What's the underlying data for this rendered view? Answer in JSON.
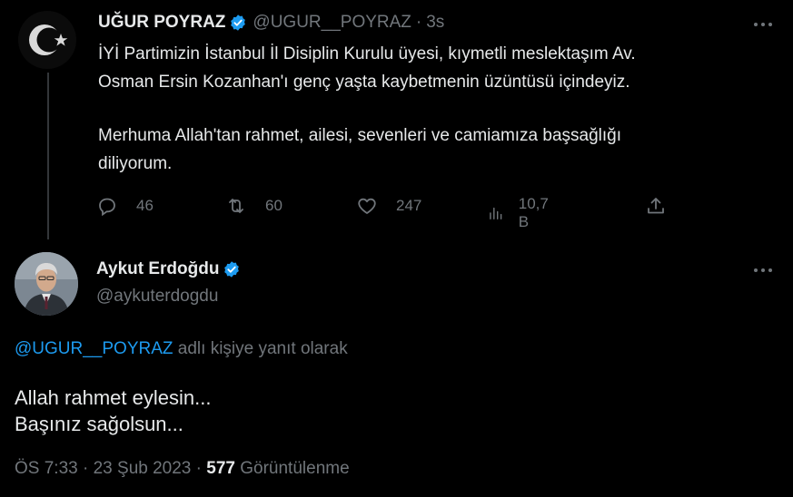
{
  "quoted_tweet": {
    "author_name": "UĞUR POYRAZ",
    "author_handle": "@UGUR__POYRAZ",
    "time_sep": "·",
    "time": "3s",
    "text_lines": [
      "İYİ Partimizin İstanbul İl Disiplin Kurulu üyesi, kıymetli meslektaşım Av.",
      "Osman Ersin Kozanhan'ı genç yaşta kaybetmenin üzüntüsü içindeyiz."
    ],
    "text_lines_2": [
      "Merhuma Allah'tan rahmet, ailesi, sevenleri ve camiamıza başsağlığı",
      "diliyorum."
    ],
    "actions": {
      "replies": "46",
      "retweets": "60",
      "likes": "247",
      "views": "10,7 B"
    }
  },
  "reply_tweet": {
    "author_name": "Aykut Erdoğdu",
    "author_handle": "@aykuterdogdu",
    "reply_mention": "@UGUR__POYRAZ",
    "reply_suffix": " adlı kişiye yanıt olarak",
    "text_lines": [
      "Allah rahmet eylesin...",
      "Başınız sağolsun..."
    ],
    "meta_time": "ÖS 7:33",
    "meta_sep": " · ",
    "meta_date": "23 Şub 2023",
    "meta_views_count": "577",
    "meta_views_label": " Görüntülenme"
  },
  "icons": {
    "verified": "verified-badge-icon",
    "more": "more-dots-icon",
    "reply": "reply-icon",
    "retweet": "retweet-icon",
    "like": "heart-icon",
    "views": "views-chart-icon",
    "share": "share-icon"
  },
  "colors": {
    "background": "#000000",
    "text": "#e7e9ea",
    "muted": "#71767b",
    "accent": "#1d9bf0"
  }
}
